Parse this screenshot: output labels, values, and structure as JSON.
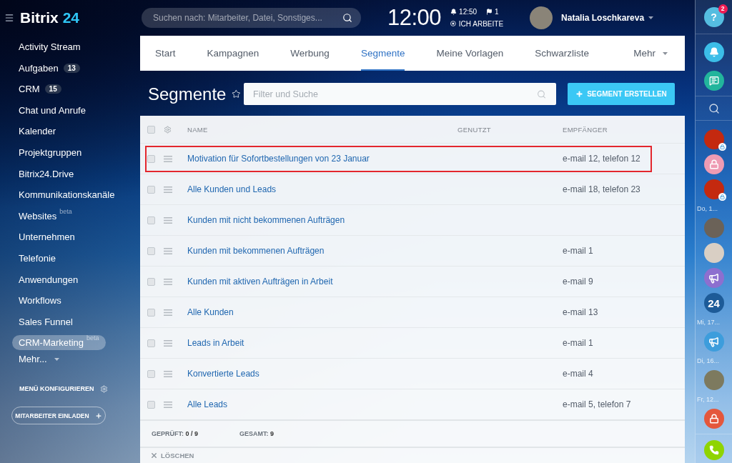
{
  "header": {
    "logo": {
      "text": "Bitrix",
      "accent": "24"
    },
    "search": {
      "placeholder": "Suchen nach: Mitarbeiter, Datei, Sonstiges..."
    },
    "clock": "12:00",
    "alarm": "12:50",
    "flags": "1",
    "work_status": "ICH ARBEITE",
    "user": {
      "name": "Natalia Loschkareva"
    }
  },
  "sidebar": {
    "items": [
      {
        "label": "Activity Stream",
        "selected": false
      },
      {
        "label": "Aufgaben",
        "counter": "13",
        "selected": false
      },
      {
        "label": "CRM",
        "counter": "15",
        "selected": false
      },
      {
        "label": "Chat und Anrufe",
        "selected": false
      },
      {
        "label": "Kalender",
        "selected": false
      },
      {
        "label": "Projektgruppen",
        "selected": false
      },
      {
        "label": "Bitrix24.Drive",
        "selected": false
      },
      {
        "label": "Kommunikationskanäle",
        "selected": false
      },
      {
        "label": "Websites",
        "tag": "beta",
        "selected": false
      },
      {
        "label": "Unternehmen",
        "selected": false
      },
      {
        "label": "Telefonie",
        "selected": false
      },
      {
        "label": "Anwendungen",
        "selected": false
      },
      {
        "label": "Workflows",
        "selected": false
      },
      {
        "label": "Sales Funnel",
        "selected": false
      },
      {
        "label": "CRM-Marketing",
        "tag": "beta",
        "selected": true
      }
    ],
    "more": "Mehr...",
    "configure": "MENÜ KONFIGURIEREN",
    "invite": "MITARBEITER EINLADEN"
  },
  "tabs": [
    {
      "label": "Start",
      "selected": false
    },
    {
      "label": "Kampagnen",
      "selected": false
    },
    {
      "label": "Werbung",
      "selected": false
    },
    {
      "label": "Segmente",
      "selected": true
    },
    {
      "label": "Meine Vorlagen",
      "selected": false
    },
    {
      "label": "Schwarzliste",
      "selected": false
    }
  ],
  "tabs_more": "Mehr",
  "page": {
    "title": "Segmente",
    "filter": {
      "placeholder": "Filter und Suche"
    },
    "create_button": "SEGMENT ERSTELLEN"
  },
  "table": {
    "select_all": {
      "checked": false
    },
    "columns": [
      "NAME",
      "GENUTZT",
      "EMPFÄNGER"
    ],
    "rows": [
      {
        "name": "Motivation für Sofortbestellungen von 23 Januar",
        "recipients": "e-mail 12, telefon 12",
        "checked": false,
        "highlighted": true
      },
      {
        "name": "Alle Kunden und Leads",
        "recipients": "e-mail 18, telefon 23",
        "checked": false,
        "highlighted": false
      },
      {
        "name": "Kunden mit nicht bekommenen Aufträgen",
        "checked": false,
        "highlighted": false
      },
      {
        "name": "Kunden mit bekommenen Aufträgen",
        "recipients": "e-mail 1",
        "checked": false,
        "highlighted": false
      },
      {
        "name": "Kunden mit aktiven Aufträgen in Arbeit",
        "recipients": "e-mail 9",
        "checked": false,
        "highlighted": false
      },
      {
        "name": "Alle Kunden",
        "recipients": "e-mail 13",
        "checked": false,
        "highlighted": false
      },
      {
        "name": "Leads in Arbeit",
        "recipients": "e-mail 1",
        "checked": false,
        "highlighted": false
      },
      {
        "name": "Konvertierte Leads",
        "recipients": "e-mail 4",
        "checked": false,
        "highlighted": false
      },
      {
        "name": "Alle Leads",
        "recipients": "e-mail 5, telefon 7",
        "checked": false,
        "highlighted": false
      }
    ]
  },
  "footer": {
    "checked": {
      "label": "GEPRÜFT:",
      "value": "0 / 9"
    },
    "total": {
      "label": "GESAMT:",
      "value": "9"
    }
  },
  "actions": [
    {
      "label": "LÖSCHEN",
      "disabled": true
    }
  ],
  "right_bar": {
    "help": {
      "label": "?",
      "badge": "2"
    },
    "contacts": [
      {
        "kind": "photo",
        "color": "#c4290f",
        "locked": true
      },
      {
        "kind": "lock",
        "color": "#ee9bb3",
        "locked": false
      },
      {
        "kind": "photo",
        "color": "#c4290f",
        "locked": true
      },
      {
        "kind": "date",
        "label": "Do, 1..."
      },
      {
        "kind": "photo",
        "color": "#6b6258",
        "locked": false
      },
      {
        "kind": "photo",
        "color": "#d9cfc4",
        "locked": false
      },
      {
        "kind": "megaphone",
        "color": "#8d6fcf",
        "locked": false
      },
      {
        "kind": "text",
        "label": "24",
        "color": "#1d5b98",
        "locked": false
      },
      {
        "kind": "date",
        "label": "Mi, 17..."
      },
      {
        "kind": "megaphone",
        "color": "#3d9ddc",
        "locked": false
      },
      {
        "kind": "date",
        "label": "Di, 16..."
      },
      {
        "kind": "photo",
        "color": "#7d7a5f",
        "locked": false
      },
      {
        "kind": "date",
        "label": "Fr, 12..."
      },
      {
        "kind": "lock",
        "color": "#e4573c",
        "locked": false
      }
    ]
  }
}
